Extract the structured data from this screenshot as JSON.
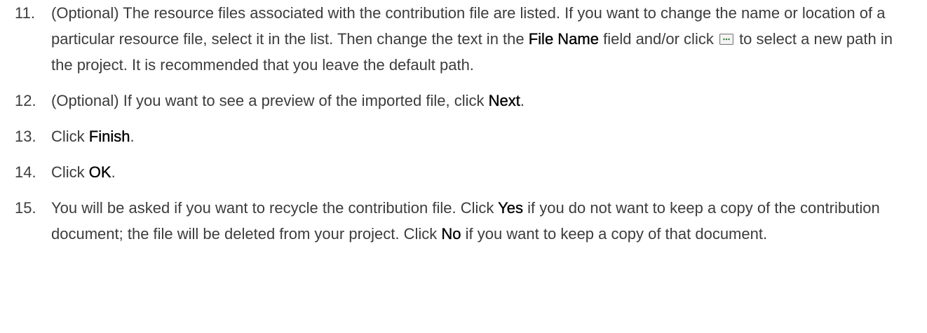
{
  "steps": [
    {
      "number": "11.",
      "parts": {
        "a": "(Optional) The resource files associated with the contribution file are listed. If you want to change the name or location of a particular resource file, select it in the list. Then change the text in the ",
        "ui1": "File Name",
        "b": " field and/or click ",
        "c": " to select a new path in the project. It is recommended that you leave the default path."
      },
      "icon": "browse-icon"
    },
    {
      "number": "12.",
      "parts": {
        "a": "(Optional) If you want to see a preview of the imported file, click ",
        "ui1": "Next",
        "b": "."
      }
    },
    {
      "number": "13.",
      "parts": {
        "a": "Click ",
        "ui1": "Finish",
        "b": "."
      }
    },
    {
      "number": "14.",
      "parts": {
        "a": "Click ",
        "ui1": "OK",
        "b": "."
      }
    },
    {
      "number": "15.",
      "parts": {
        "a": "You will be asked if you want to recycle the contribution file. Click ",
        "ui1": "Yes",
        "b": " if you do not want to keep a copy of the contribution document; the file will be deleted from your project. Click ",
        "ui2": "No",
        "c": " if you want to keep a copy of that document."
      }
    }
  ],
  "colors": {
    "text": "#3c3c3c",
    "ui_label": "#000000",
    "icon_border": "#7a7a7a",
    "icon_fill": "#e6e6e6",
    "icon_dots": "#2e7d32"
  }
}
